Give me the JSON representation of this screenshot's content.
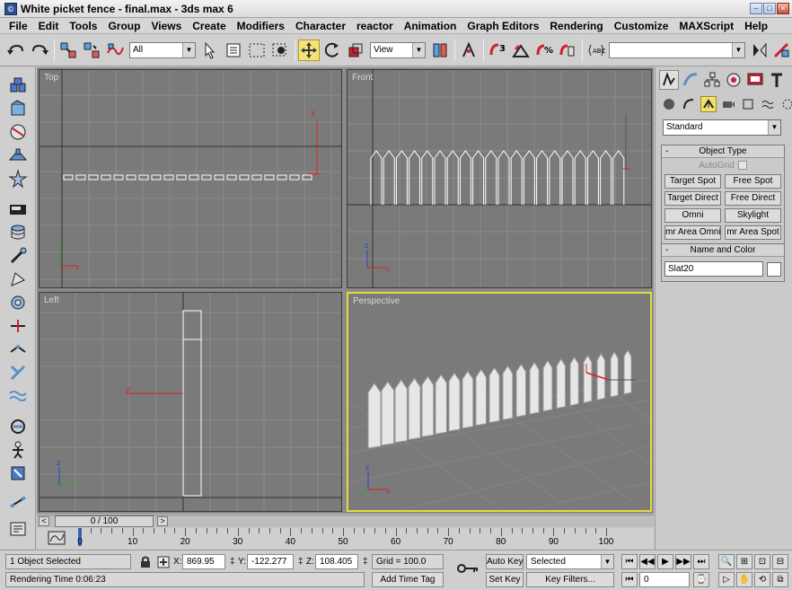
{
  "window": {
    "title": "White picket fence - final.max - 3ds max 6"
  },
  "menu": [
    "File",
    "Edit",
    "Tools",
    "Group",
    "Views",
    "Create",
    "Modifiers",
    "Character",
    "reactor",
    "Animation",
    "Graph Editors",
    "Rendering",
    "Customize",
    "MAXScript",
    "Help"
  ],
  "toolbar": {
    "selection_filter": "All",
    "ref_coord": "View",
    "named_selection": ""
  },
  "viewports": {
    "top": "Top",
    "front": "Front",
    "left": "Left",
    "perspective": "Perspective"
  },
  "command_panel": {
    "category": "Standard",
    "object_type": {
      "title": "Object Type",
      "autogrid": "AutoGrid",
      "buttons": [
        "Target Spot",
        "Free Spot",
        "Target Direct",
        "Free Direct",
        "Omni",
        "Skylight",
        "mr Area Omni",
        "mr Area Spot"
      ]
    },
    "name_color": {
      "title": "Name and Color",
      "name": "Slat20",
      "color": "#ffffff"
    }
  },
  "time_slider": {
    "position": "0 / 100",
    "ticks": [
      "0",
      "10",
      "20",
      "30",
      "40",
      "50",
      "60",
      "70",
      "80",
      "90",
      "100"
    ]
  },
  "status": {
    "selection": "1 Object Selected",
    "render_time": "Rendering Time  0:06:23",
    "x_label": "X:",
    "x": "869.95",
    "y_label": "Y:",
    "y": "-122.277",
    "z_label": "Z:",
    "z": "108.405",
    "grid": "Grid = 100.0",
    "add_time_tag": "Add Time Tag",
    "auto_key": "Auto Key",
    "set_key": "Set Key",
    "key_mode": "Selected",
    "key_filters": "Key Filters...",
    "current_frame": "0"
  },
  "colors": {
    "viewport_bg": "#7a7a7a",
    "active_border": "#e8d83a",
    "grid_line": "#8c8c8c",
    "axis_line": "#333333"
  }
}
